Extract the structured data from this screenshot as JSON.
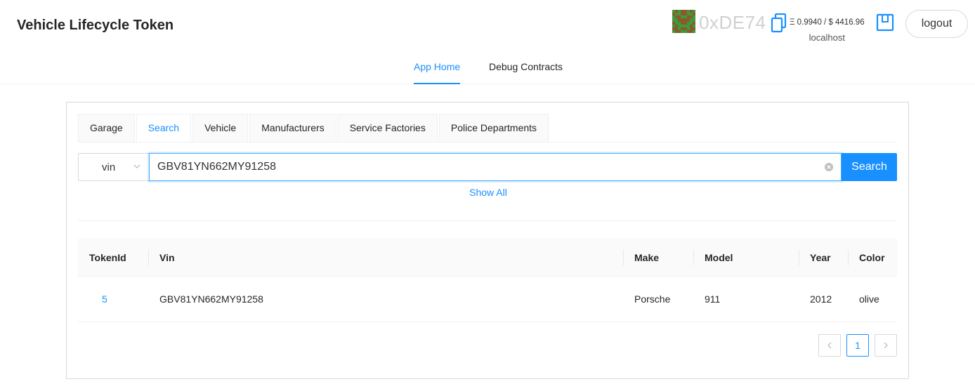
{
  "header": {
    "app_title": "Vehicle Lifecycle Token",
    "address": "0xDE74",
    "balance": "Ξ 0.9940 / $ 4416.96",
    "network": "localhost",
    "logout_label": "logout"
  },
  "nav": {
    "items": [
      {
        "label": "App Home",
        "active": true
      },
      {
        "label": "Debug Contracts",
        "active": false
      }
    ]
  },
  "tabs": [
    "Garage",
    "Search",
    "Vehicle",
    "Manufacturers",
    "Service Factories",
    "Police Departments"
  ],
  "active_tab": "Search",
  "search": {
    "field_select": "vin",
    "query": "GBV81YN662MY91258",
    "button_label": "Search",
    "show_all_label": "Show All"
  },
  "table": {
    "columns": [
      "TokenId",
      "Vin",
      "Make",
      "Model",
      "Year",
      "Color"
    ],
    "rows": [
      {
        "tokenId": "5",
        "vin": "GBV81YN662MY91258",
        "make": "Porsche",
        "model": "911",
        "year": "2012",
        "color": "olive"
      }
    ]
  },
  "pagination": {
    "current_page": "1"
  },
  "colors": {
    "accent": "#1890ff",
    "blockie_green": "#3f9b3a",
    "blockie_brown": "#8a5a2b"
  }
}
